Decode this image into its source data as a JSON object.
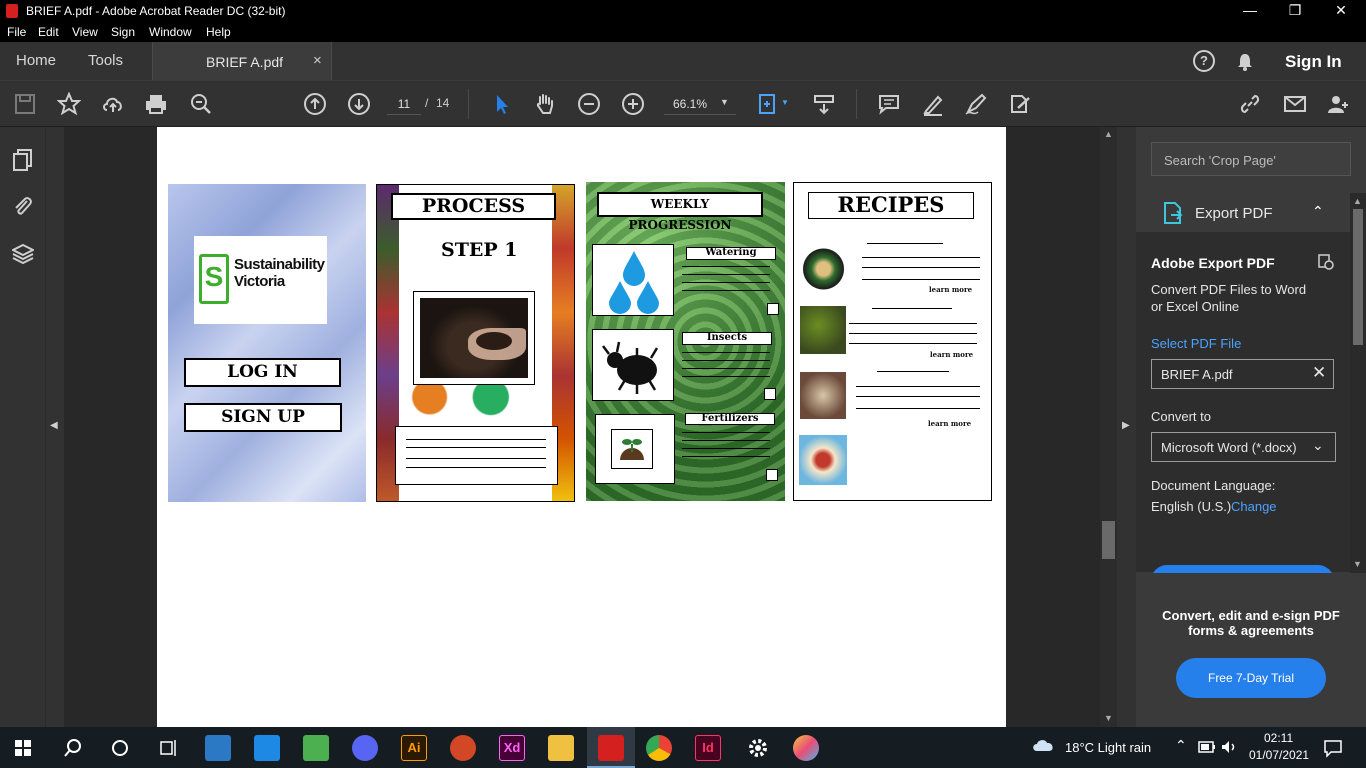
{
  "window": {
    "title": "BRIEF A.pdf - Adobe Acrobat Reader DC (32-bit)",
    "controls": {
      "minimize": "—",
      "restore": "❐",
      "close": "✕"
    }
  },
  "menu": [
    "File",
    "Edit",
    "View",
    "Sign",
    "Window",
    "Help"
  ],
  "tabs": {
    "home": "Home",
    "tools": "Tools",
    "doc": "BRIEF A.pdf",
    "close": "×"
  },
  "header_right": {
    "help": "?",
    "sign_in": "Sign In"
  },
  "toolbar": {
    "page_current": "11",
    "page_sep": "/",
    "page_total": "14",
    "zoom": "66.1%"
  },
  "document": {
    "panel1": {
      "logo_line1": "Sustainability",
      "logo_line2": "Victoria",
      "logo_mark": "S",
      "login": "LOG IN",
      "signup": "SIGN UP"
    },
    "panel2": {
      "title": "PROCESS",
      "step": "STEP 1"
    },
    "panel3": {
      "title": "WEEKLY PROGRESSION",
      "watering": "Watering",
      "insects": "Insects",
      "fertilizers": "Fertilizers"
    },
    "panel4": {
      "title": "RECIPES",
      "learn_more": "learn more"
    }
  },
  "right_pane": {
    "search_placeholder": "Search 'Crop Page'",
    "export_header": "Export PDF",
    "heading": "Adobe Export PDF",
    "description": "Convert PDF Files to Word or Excel Online",
    "select_label": "Select PDF File",
    "file_name": "BRIEF A.pdf",
    "convert_to_label": "Convert to",
    "convert_to_value": "Microsoft Word (*.docx)",
    "doc_lang_label": "Document Language:",
    "doc_lang_value": "English (U.S.)",
    "change": "Change",
    "promo": "Convert, edit and e-sign PDF forms & agreements",
    "trial_button": "Free 7-Day Trial"
  },
  "taskbar": {
    "weather": "18°C  Light rain",
    "time": "02:11",
    "date": "01/07/2021"
  },
  "colors": {
    "accent": "#2680eb",
    "acrobat_red": "#d4211f",
    "link": "#4aa3ff"
  }
}
